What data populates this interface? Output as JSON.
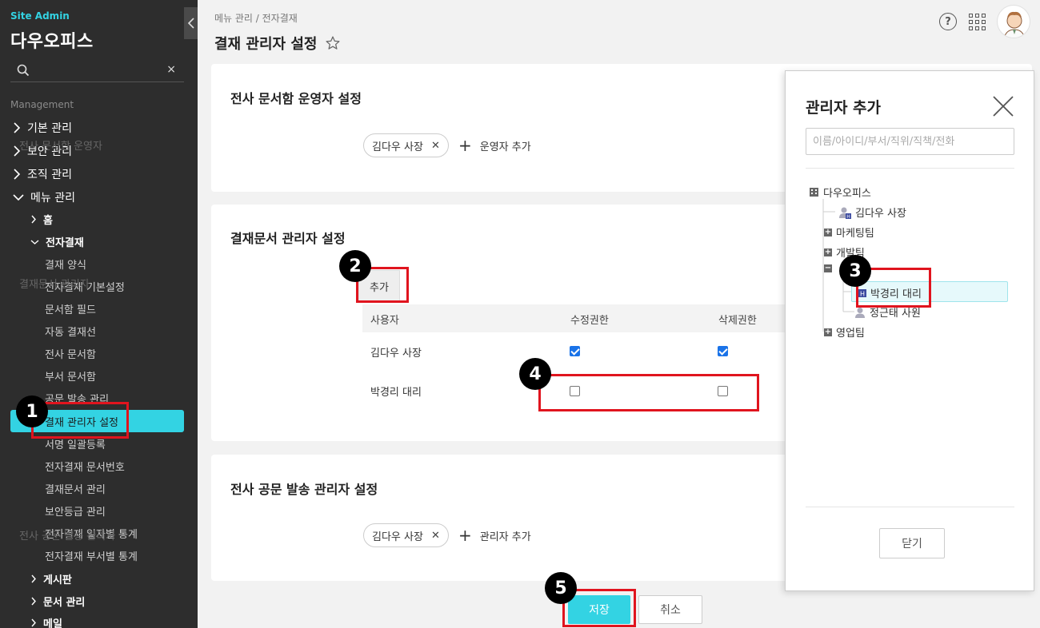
{
  "sidebar": {
    "brand_small": "Site Admin",
    "brand_big": "다우오피스",
    "search_clear": "×",
    "section_label": "Management",
    "top_items": [
      "기본 관리",
      "보안 관리",
      "조직 관리",
      "메뉴 관리"
    ],
    "sub_items": {
      "home": "홈",
      "approval": "전자결재",
      "board": "게시판",
      "docs": "문서 관리",
      "mail": "메일"
    },
    "approval_leaves": [
      "결재 양식",
      "전자결재 기본설정",
      "문서함 필드",
      "자동 결재선",
      "전사 문서함",
      "부서 문서함",
      "공문 발송 관리",
      "결재 관리자 설정",
      "서명 일괄등록",
      "전자결재 문서번호",
      "결재문서 관리",
      "보안등급 관리",
      "전자결재 일자별 통계",
      "전자결재 부서별 통계"
    ],
    "active_item": "결재 관리자 설정"
  },
  "header": {
    "breadcrumb": "메뉴 관리 / 전자결재",
    "title": "결재 관리자 설정",
    "help": "?"
  },
  "section1": {
    "title": "전사 문서함 운영자 설정",
    "row_label": "전사 문서함 운영자",
    "chip": "김다우 사장",
    "add_label": "운영자 추가"
  },
  "section2": {
    "title": "결재문서 관리자 설정",
    "row_label": "결재문서 관리자",
    "add_button": "추가",
    "columns": [
      "사용자",
      "수정권한",
      "삭제권한"
    ],
    "rows": [
      {
        "user": "김다우 사장",
        "edit": true,
        "delete": true
      },
      {
        "user": "박경리 대리",
        "edit": false,
        "delete": false
      }
    ]
  },
  "section3": {
    "title": "전사 공문 발송 관리자 설정",
    "row_label": "전사 공문 발송 관리자",
    "chip": "김다우 사장",
    "add_label": "관리자 추가"
  },
  "footer": {
    "save": "저장",
    "cancel": "취소"
  },
  "panel": {
    "title": "관리자 추가",
    "search_placeholder": "이름/아이디/부서/직위/직책/전화",
    "tree": {
      "root": "다우오피스",
      "ceo": "김다우 사장",
      "marketing": "마케팅팀",
      "dev": "개발팀",
      "selected": "박경리 대리",
      "member2": "정근태 사원",
      "sales": "영업팀"
    },
    "close_button": "닫기"
  },
  "annotations": [
    "1",
    "2",
    "3",
    "4",
    "5"
  ],
  "colors": {
    "accent": "#33d3e3",
    "sidebar_bg": "#2d2d2d",
    "annotation_red": "#e0141e",
    "checkbox_on": "#1a73e8"
  }
}
